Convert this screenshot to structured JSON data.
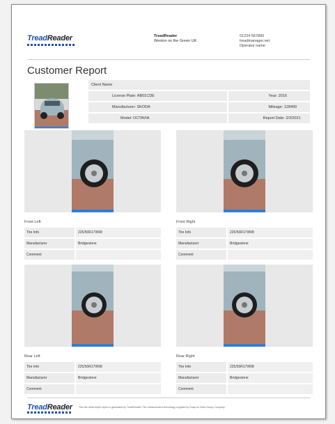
{
  "logo": {
    "tread": "Tread",
    "reader": "Reader"
  },
  "company": {
    "name": "TreadReader",
    "location": "Weston on the Green UK"
  },
  "contact": {
    "phone": "01234 567890",
    "site": "treadmanager.net",
    "operator": "Operator name"
  },
  "title": "Customer Report",
  "vehicle": {
    "client_name": "Client Name",
    "license_plate": "License Plate: AB01CDE",
    "year": "Year: 2016",
    "manufacturer": "Manufacturer: SKODA",
    "mileage": "Mileage: 128490",
    "model": "Model: OCTAVIA",
    "report_date": "Report Date: 2/3/2021"
  },
  "tyres": [
    {
      "position": "Front Left",
      "tire_info_label": "Tire Info",
      "tire_info": "225/50R17W98",
      "manufacturer_label": "Manufacturer",
      "manufacturer": "Bridgestone",
      "comment_label": "Comment",
      "comment": ""
    },
    {
      "position": "Front Right",
      "tire_info_label": "Tire Info",
      "tire_info": "225/50R17W98",
      "manufacturer_label": "Manufacturer",
      "manufacturer": "Bridgestone",
      "comment_label": "Comment",
      "comment": ""
    },
    {
      "position": "Rear Left",
      "tire_info_label": "Tire Info",
      "tire_info": "225/50R17W98",
      "manufacturer_label": "Manufacturer",
      "manufacturer": "Bridgestone",
      "comment_label": "Comment",
      "comment": ""
    },
    {
      "position": "Rear Right",
      "tire_info_label": "Tire Info",
      "tire_info": "225/50R17W98",
      "manufacturer_label": "Manufacturer",
      "manufacturer": "Bridgestone",
      "comment_label": "Comment",
      "comment": ""
    }
  ],
  "footer": {
    "text": "This tire tread depth report is generated by TreadReader. Tire measurement technology supplied by Snap-on Tools Group Company."
  },
  "colors": {
    "brand_blue": "#1f4fb0",
    "car_body": "#9fb4bd",
    "brick": "#b07a68"
  }
}
